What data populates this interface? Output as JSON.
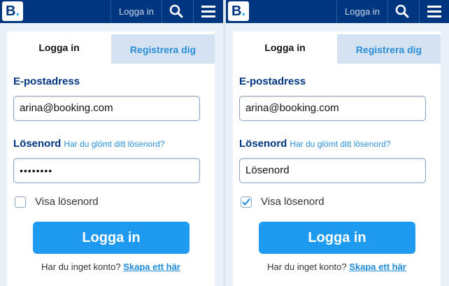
{
  "colors": {
    "brand_blue": "#003580",
    "accent_blue": "#1e9af0",
    "link_blue": "#2a8fd8"
  },
  "panels": [
    {
      "header": {
        "logo_text": "B",
        "logo_dot": ".",
        "login_label": "Logga in",
        "search_icon": "search-icon",
        "menu_icon": "menu-icon"
      },
      "tabs": {
        "login": "Logga in",
        "register": "Registrera dig"
      },
      "form": {
        "email_label": "E-postadress",
        "email_value": "arina@booking.com",
        "password_label": "Lösenord",
        "forgot_link": "Har du glömt ditt lösenord?",
        "password_value": "••••••••",
        "show_password_label": "Visa lösenord",
        "show_password_checked": false,
        "submit_label": "Logga in",
        "no_account_text": "Har du inget konto?",
        "create_link": "Skapa ett här"
      }
    },
    {
      "header": {
        "logo_text": "B",
        "logo_dot": ".",
        "login_label": "Logga in",
        "search_icon": "search-icon",
        "menu_icon": "menu-icon"
      },
      "tabs": {
        "login": "Logga in",
        "register": "Registrera dig"
      },
      "form": {
        "email_label": "E-postadress",
        "email_value": "arina@booking.com",
        "password_label": "Lösenord",
        "forgot_link": "Har du glömt ditt lösenord?",
        "password_value": "Lösenord",
        "show_password_label": "Visa lösenord",
        "show_password_checked": true,
        "submit_label": "Logga in",
        "no_account_text": "Har du inget konto?",
        "create_link": "Skapa ett här"
      }
    }
  ]
}
